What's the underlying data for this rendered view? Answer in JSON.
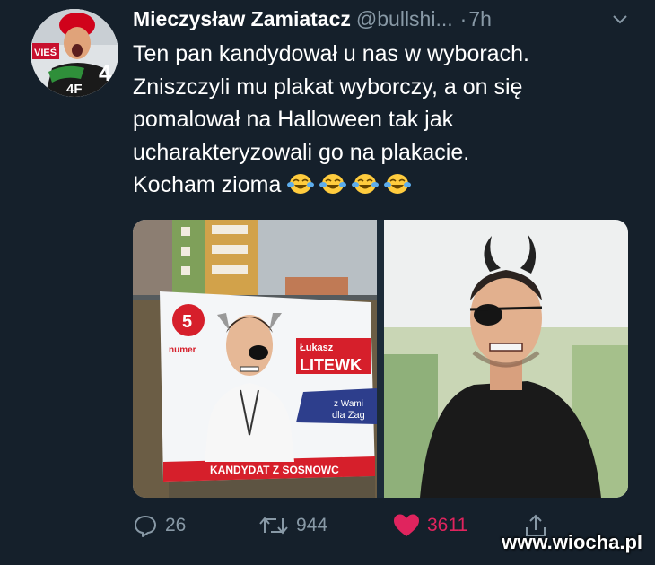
{
  "tweet": {
    "display_name": "Mieczysław Zamiatacz",
    "handle": "@bullshi...",
    "separator": "·",
    "time": "7h",
    "text_lines": [
      "Ten pan kandydował u nas w wyborach.",
      "Zniszczyli mu plakat wyborczy, a on się",
      "pomalował na Halloween tak jak",
      "ucharakteryzowali go na plakacie.",
      "Kocham zioma"
    ],
    "emoji_count": 4,
    "emoji_name": "face-with-tears-of-joy-icon"
  },
  "avatar": {
    "shirt_text": "4F",
    "banner_text": "VIEŚ",
    "number_text": "4"
  },
  "poster": {
    "number": "5",
    "number_label": "numer",
    "first_name": "Łukasz",
    "last_name": "LITEWK",
    "slogan_1": "z Wami",
    "slogan_2": "dla Zag",
    "footer": "KANDYDAT Z SOSNOWC"
  },
  "actions": {
    "reply_count": "26",
    "retweet_count": "944",
    "like_count": "3611"
  },
  "watermark": "www.wiocha.pl",
  "colors": {
    "background": "#15202b",
    "secondary_text": "#8899a6",
    "like": "#e0245e"
  }
}
